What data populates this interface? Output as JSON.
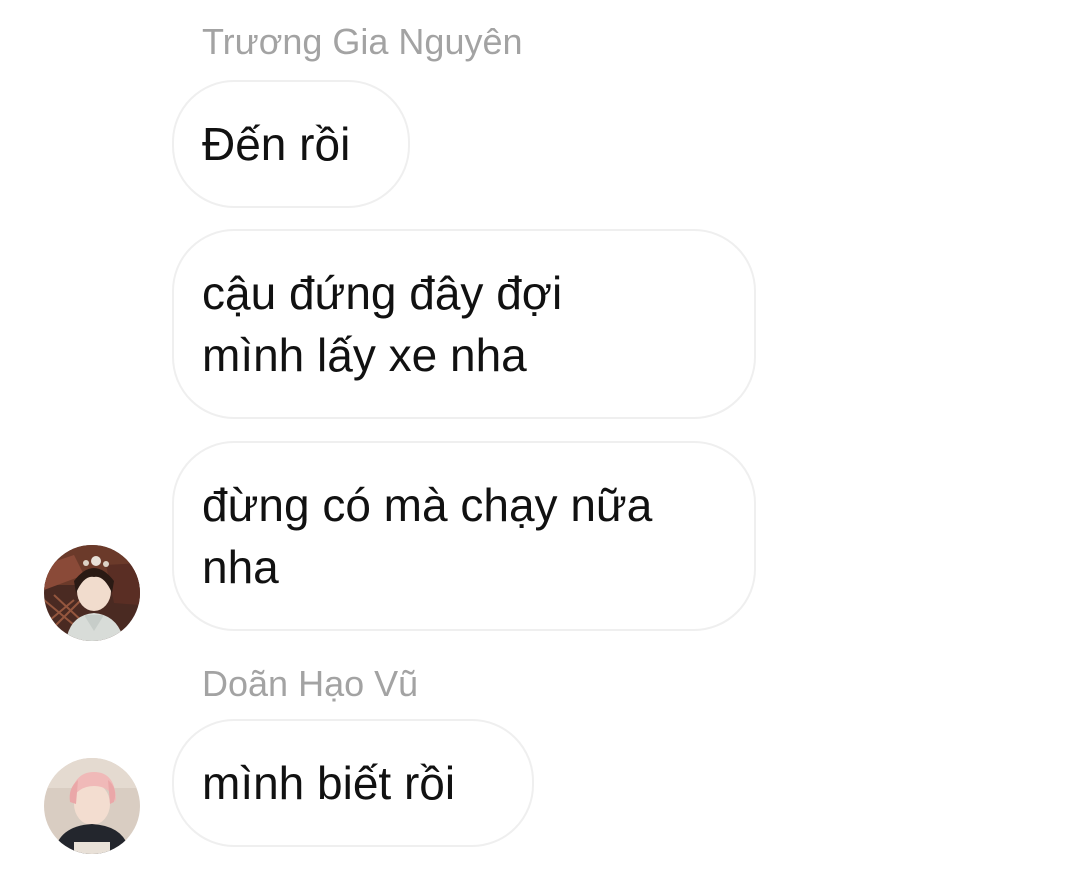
{
  "conversation": {
    "groups": [
      {
        "sender": "Trương Gia Nguyên",
        "messages": [
          "Đến rồi",
          "cậu đứng đây đợi\nmình lấy xe nha",
          "đừng có mà chạy nữa\nnha"
        ],
        "avatar_icon": "profile-photo-icon"
      },
      {
        "sender": "Doãn Hạo Vũ",
        "messages": [
          "mình biết rồi"
        ],
        "avatar_icon": "profile-photo-icon"
      }
    ]
  }
}
